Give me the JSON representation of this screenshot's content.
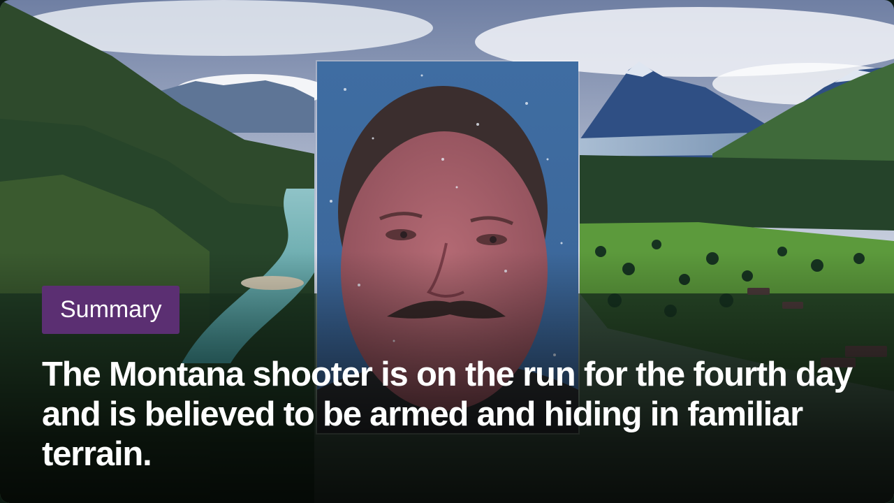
{
  "card": {
    "tag_label": "Summary",
    "headline": "The Montana shooter is on the run for the fourth day and is believed to be armed and hiding in familiar terrain."
  },
  "colors": {
    "tag_background": "#5b2f72",
    "headline_text": "#ffffff"
  }
}
